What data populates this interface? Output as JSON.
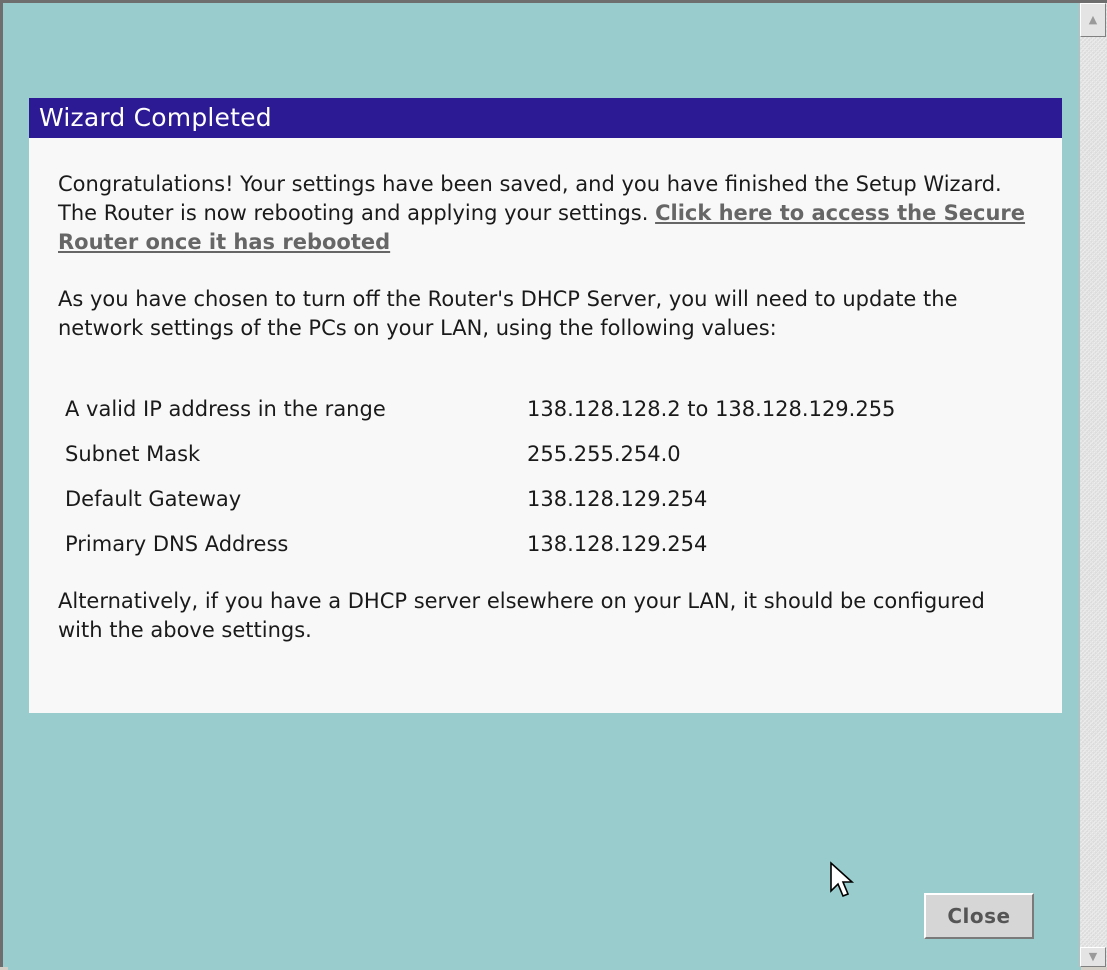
{
  "panel": {
    "title": "Wizard Completed",
    "intro_text": "Congratulations! Your settings have been saved, and you have finished the Setup Wizard. The Router is now rebooting and applying your settings. ",
    "intro_link": "Click here to access the Secure Router once it has rebooted",
    "dhcp_text": "As you have chosen to turn off the Router's DHCP Server, you will need to update the network settings of the PCs on your LAN, using the following values:",
    "settings": [
      {
        "label": "A valid IP address in the range",
        "value": "138.128.128.2 to 138.128.129.255"
      },
      {
        "label": "Subnet Mask",
        "value": "255.255.254.0"
      },
      {
        "label": "Default Gateway",
        "value": "138.128.129.254"
      },
      {
        "label": "Primary DNS Address",
        "value": "138.128.129.254"
      }
    ],
    "alternative_text": "Alternatively, if you have a DHCP server elsewhere on your LAN, it should be configured with the above settings."
  },
  "buttons": {
    "close_label": "Close"
  },
  "icons": {
    "scroll_up": "scroll-up-arrow-icon",
    "scroll_down": "scroll-down-arrow-icon",
    "cursor": "mouse-pointer-icon"
  },
  "colors": {
    "page_background": "#99cccc",
    "header_background": "#2c1a94",
    "panel_background": "#f8f8f8",
    "link_color": "#666666"
  }
}
